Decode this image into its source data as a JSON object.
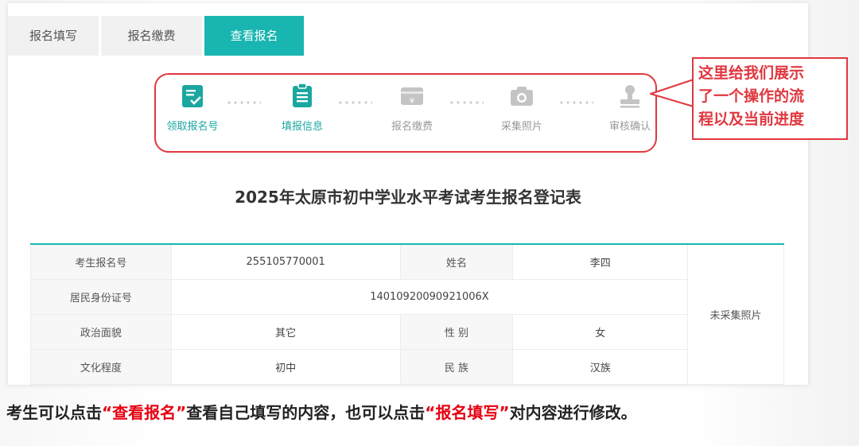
{
  "tabs": [
    {
      "label": "报名填写",
      "active": false
    },
    {
      "label": "报名缴费",
      "active": false
    },
    {
      "label": "查看报名",
      "active": true
    }
  ],
  "steps": [
    {
      "label": "领取报名号",
      "icon": "clipboard-check-icon",
      "state": "done"
    },
    {
      "label": "填报信息",
      "icon": "clipboard-list-icon",
      "state": "done"
    },
    {
      "label": "报名缴费",
      "icon": "yuan-card-icon",
      "state": "todo"
    },
    {
      "label": "采集照片",
      "icon": "camera-icon",
      "state": "todo"
    },
    {
      "label": "审核确认",
      "icon": "stamp-icon",
      "state": "todo"
    }
  ],
  "form": {
    "title": "2025年太原市初中学业水平考试考生报名登记表",
    "rows": [
      {
        "label1": "考生报名号",
        "value1": "255105770001",
        "label2": "姓名",
        "value2": "李四"
      },
      {
        "label1": "居民身份证号",
        "value1": "14010920090921006X"
      },
      {
        "label1": "政治面貌",
        "value1": "其它",
        "label2": "性 别",
        "value2": "女"
      },
      {
        "label1": "文化程度",
        "value1": "初中",
        "label2": "民 族",
        "value2": "汉族"
      }
    ],
    "photo_text": "未采集照片"
  },
  "callout": {
    "line1": "这里给我们展示",
    "line2": "了一个操作的流",
    "line3": "程以及当前进度"
  },
  "caption": {
    "part1": "考生可以点击",
    "quote1": "“查看报名”",
    "part2": "查看自己填写的内容，也可以点击",
    "quote2": "“报名填写”",
    "part3": "对内容进行修改。"
  },
  "colors": {
    "accent": "#19b5b0",
    "step_done": "#1aa7a0",
    "step_todo": "#c4c4c4",
    "highlight_red": "#e1373f",
    "caption_red": "#e60012"
  }
}
